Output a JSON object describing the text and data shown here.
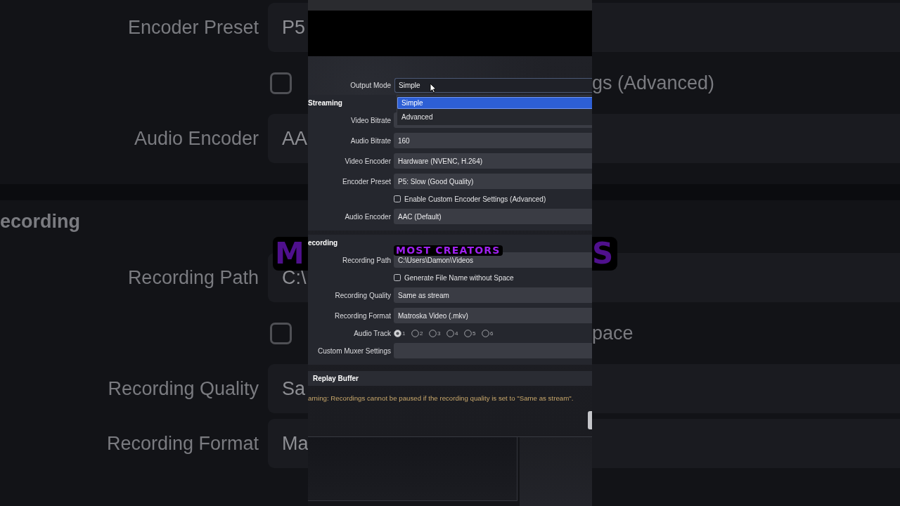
{
  "backdrop": {
    "rows": [
      {
        "kind": "field",
        "label": "Encoder Preset",
        "value": "P5"
      },
      {
        "kind": "checkbox",
        "checked": false,
        "right_text": "gs (Advanced)"
      },
      {
        "kind": "field",
        "label": "Audio Encoder",
        "value": "AA"
      },
      {
        "kind": "section",
        "title": "ecording"
      },
      {
        "kind": "field",
        "label": "Recording Path",
        "value": "C:\\",
        "caption_left": "M",
        "caption_right": "S"
      },
      {
        "kind": "checkbox",
        "checked": false,
        "right_text": "pace"
      },
      {
        "kind": "field",
        "label": "Recording Quality",
        "value": "Sa"
      },
      {
        "kind": "field",
        "label": "Recording Format",
        "value": "Ma"
      }
    ]
  },
  "settings": {
    "output_mode": {
      "label": "Output Mode",
      "value": "Simple",
      "expanded": true,
      "options": [
        {
          "label": "Simple",
          "selected": true
        },
        {
          "label": "Advanced",
          "selected": false
        }
      ]
    },
    "groups": [
      {
        "title": "Streaming",
        "rows": [
          {
            "kind": "field",
            "label": "Video Bitrate"
          },
          {
            "kind": "field",
            "label": "Audio Bitrate",
            "value": "160"
          },
          {
            "kind": "field",
            "label": "Video Encoder",
            "value": "Hardware (NVENC, H.264)"
          },
          {
            "kind": "field",
            "label": "Encoder Preset",
            "value": "P5: Slow (Good Quality)"
          },
          {
            "kind": "checkbox",
            "label": "Enable Custom Encoder Settings (Advanced)",
            "checked": false
          },
          {
            "kind": "field",
            "label": "Audio Encoder",
            "value": "AAC (Default)"
          }
        ]
      },
      {
        "title": "ecording",
        "rows": [
          {
            "kind": "field",
            "label": "Recording Path",
            "value": "C:\\Users\\Damon\\Videos"
          },
          {
            "kind": "checkbox",
            "label": "Generate File Name without Space",
            "checked": false
          },
          {
            "kind": "field",
            "label": "Recording Quality",
            "value": "Same as stream"
          },
          {
            "kind": "field",
            "label": "Recording Format",
            "value": "Matroska Video (.mkv)"
          },
          {
            "kind": "radios",
            "label": "Audio Track",
            "options": [
              {
                "label": "1",
                "selected": true
              },
              {
                "label": "2",
                "selected": false
              },
              {
                "label": "3",
                "selected": false
              },
              {
                "label": "4",
                "selected": false
              },
              {
                "label": "5",
                "selected": false
              },
              {
                "label": "6",
                "selected": false
              }
            ]
          },
          {
            "kind": "field",
            "label": "Custom Muxer Settings"
          }
        ]
      },
      {
        "title": "Replay Buffer"
      }
    ],
    "warning": "arning: Recordings cannot be paused if the recording quality is set to \"Same as stream\".",
    "caption": "MOST CREATORS"
  }
}
